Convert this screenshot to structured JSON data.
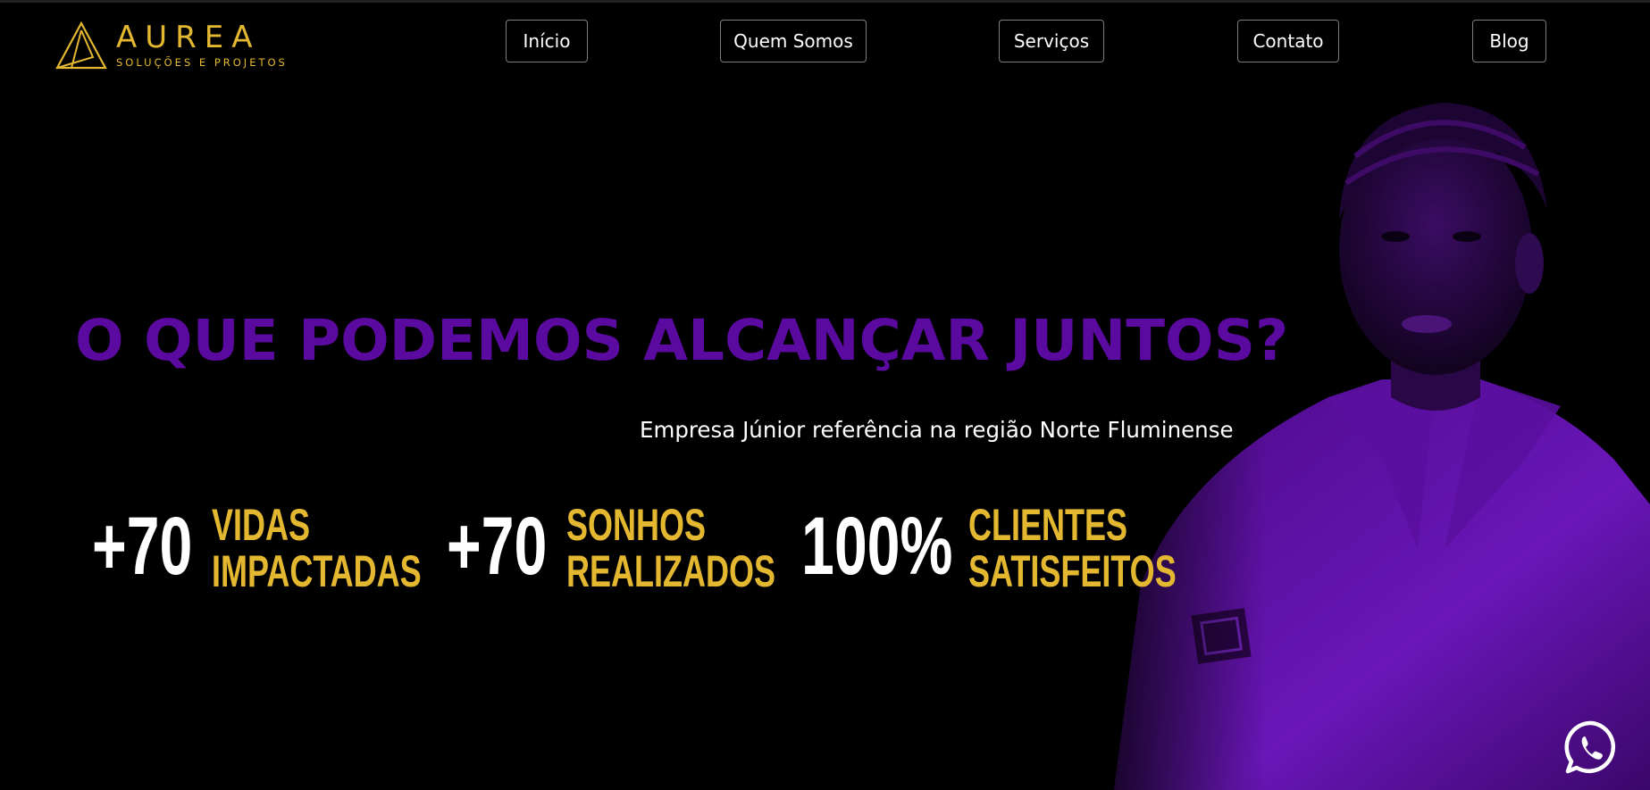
{
  "brand": {
    "name": "AUREA",
    "tagline": "SOLUÇÕES E PROJETOS",
    "color": "#e3b830"
  },
  "nav": [
    {
      "label": "Início"
    },
    {
      "label": "Quem Somos"
    },
    {
      "label": "Serviços"
    },
    {
      "label": "Contato"
    },
    {
      "label": "Blog"
    }
  ],
  "hero": {
    "headline": "O QUE PODEMOS ALCANÇAR JUNTOS?",
    "headline_color": "#5a0a9e",
    "subtitle": "Empresa Júnior referência na região Norte Fluminense",
    "image": "purple-tinted-portrait"
  },
  "stats": [
    {
      "number": "+70",
      "label_line1": "VIDAS",
      "label_line2": "IMPACTADAS"
    },
    {
      "number": "+70",
      "label_line1": "SONHOS",
      "label_line2": "REALIZADOS"
    },
    {
      "number": "100%",
      "label_line1": "CLIENTES",
      "label_line2": "SATISFEITOS"
    }
  ],
  "whatsapp": {
    "icon": "whatsapp-icon"
  }
}
